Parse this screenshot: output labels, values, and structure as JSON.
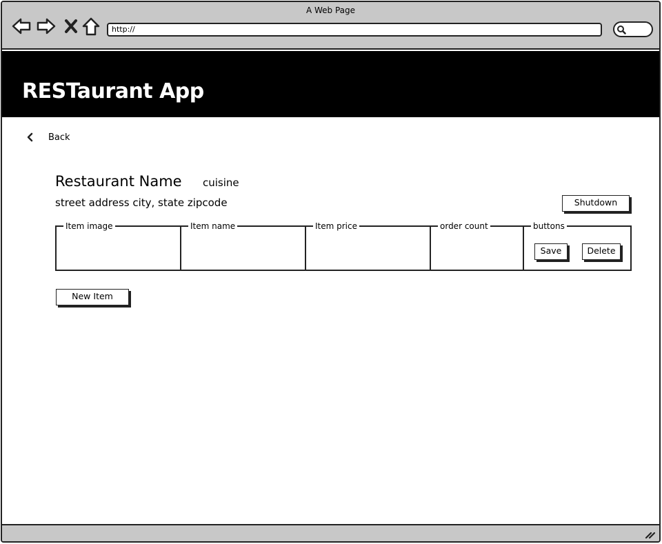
{
  "window": {
    "title": "A Web Page",
    "url": "http://"
  },
  "icons": {
    "back": "arrow-left-icon",
    "forward": "arrow-right-icon",
    "stop": "close-icon",
    "home": "home-icon",
    "search": "search-icon",
    "resize": "resize-grip-icon"
  },
  "header": {
    "title": "RESTaurant App"
  },
  "nav": {
    "back_label": "Back"
  },
  "restaurant": {
    "name": "Restaurant Name",
    "cuisine": "cuisine",
    "address": "street address city, state zipcode"
  },
  "actions": {
    "shutdown_label": "Shutdown",
    "new_item_label": "New Item"
  },
  "item_row": {
    "columns": [
      "Item image",
      "Item name",
      "Item price",
      "order count",
      "buttons"
    ],
    "save_label": "Save",
    "delete_label": "Delete"
  },
  "colors": {
    "chrome": "#c8c8c8",
    "header_bg": "#000000",
    "header_text": "#ffffff"
  }
}
